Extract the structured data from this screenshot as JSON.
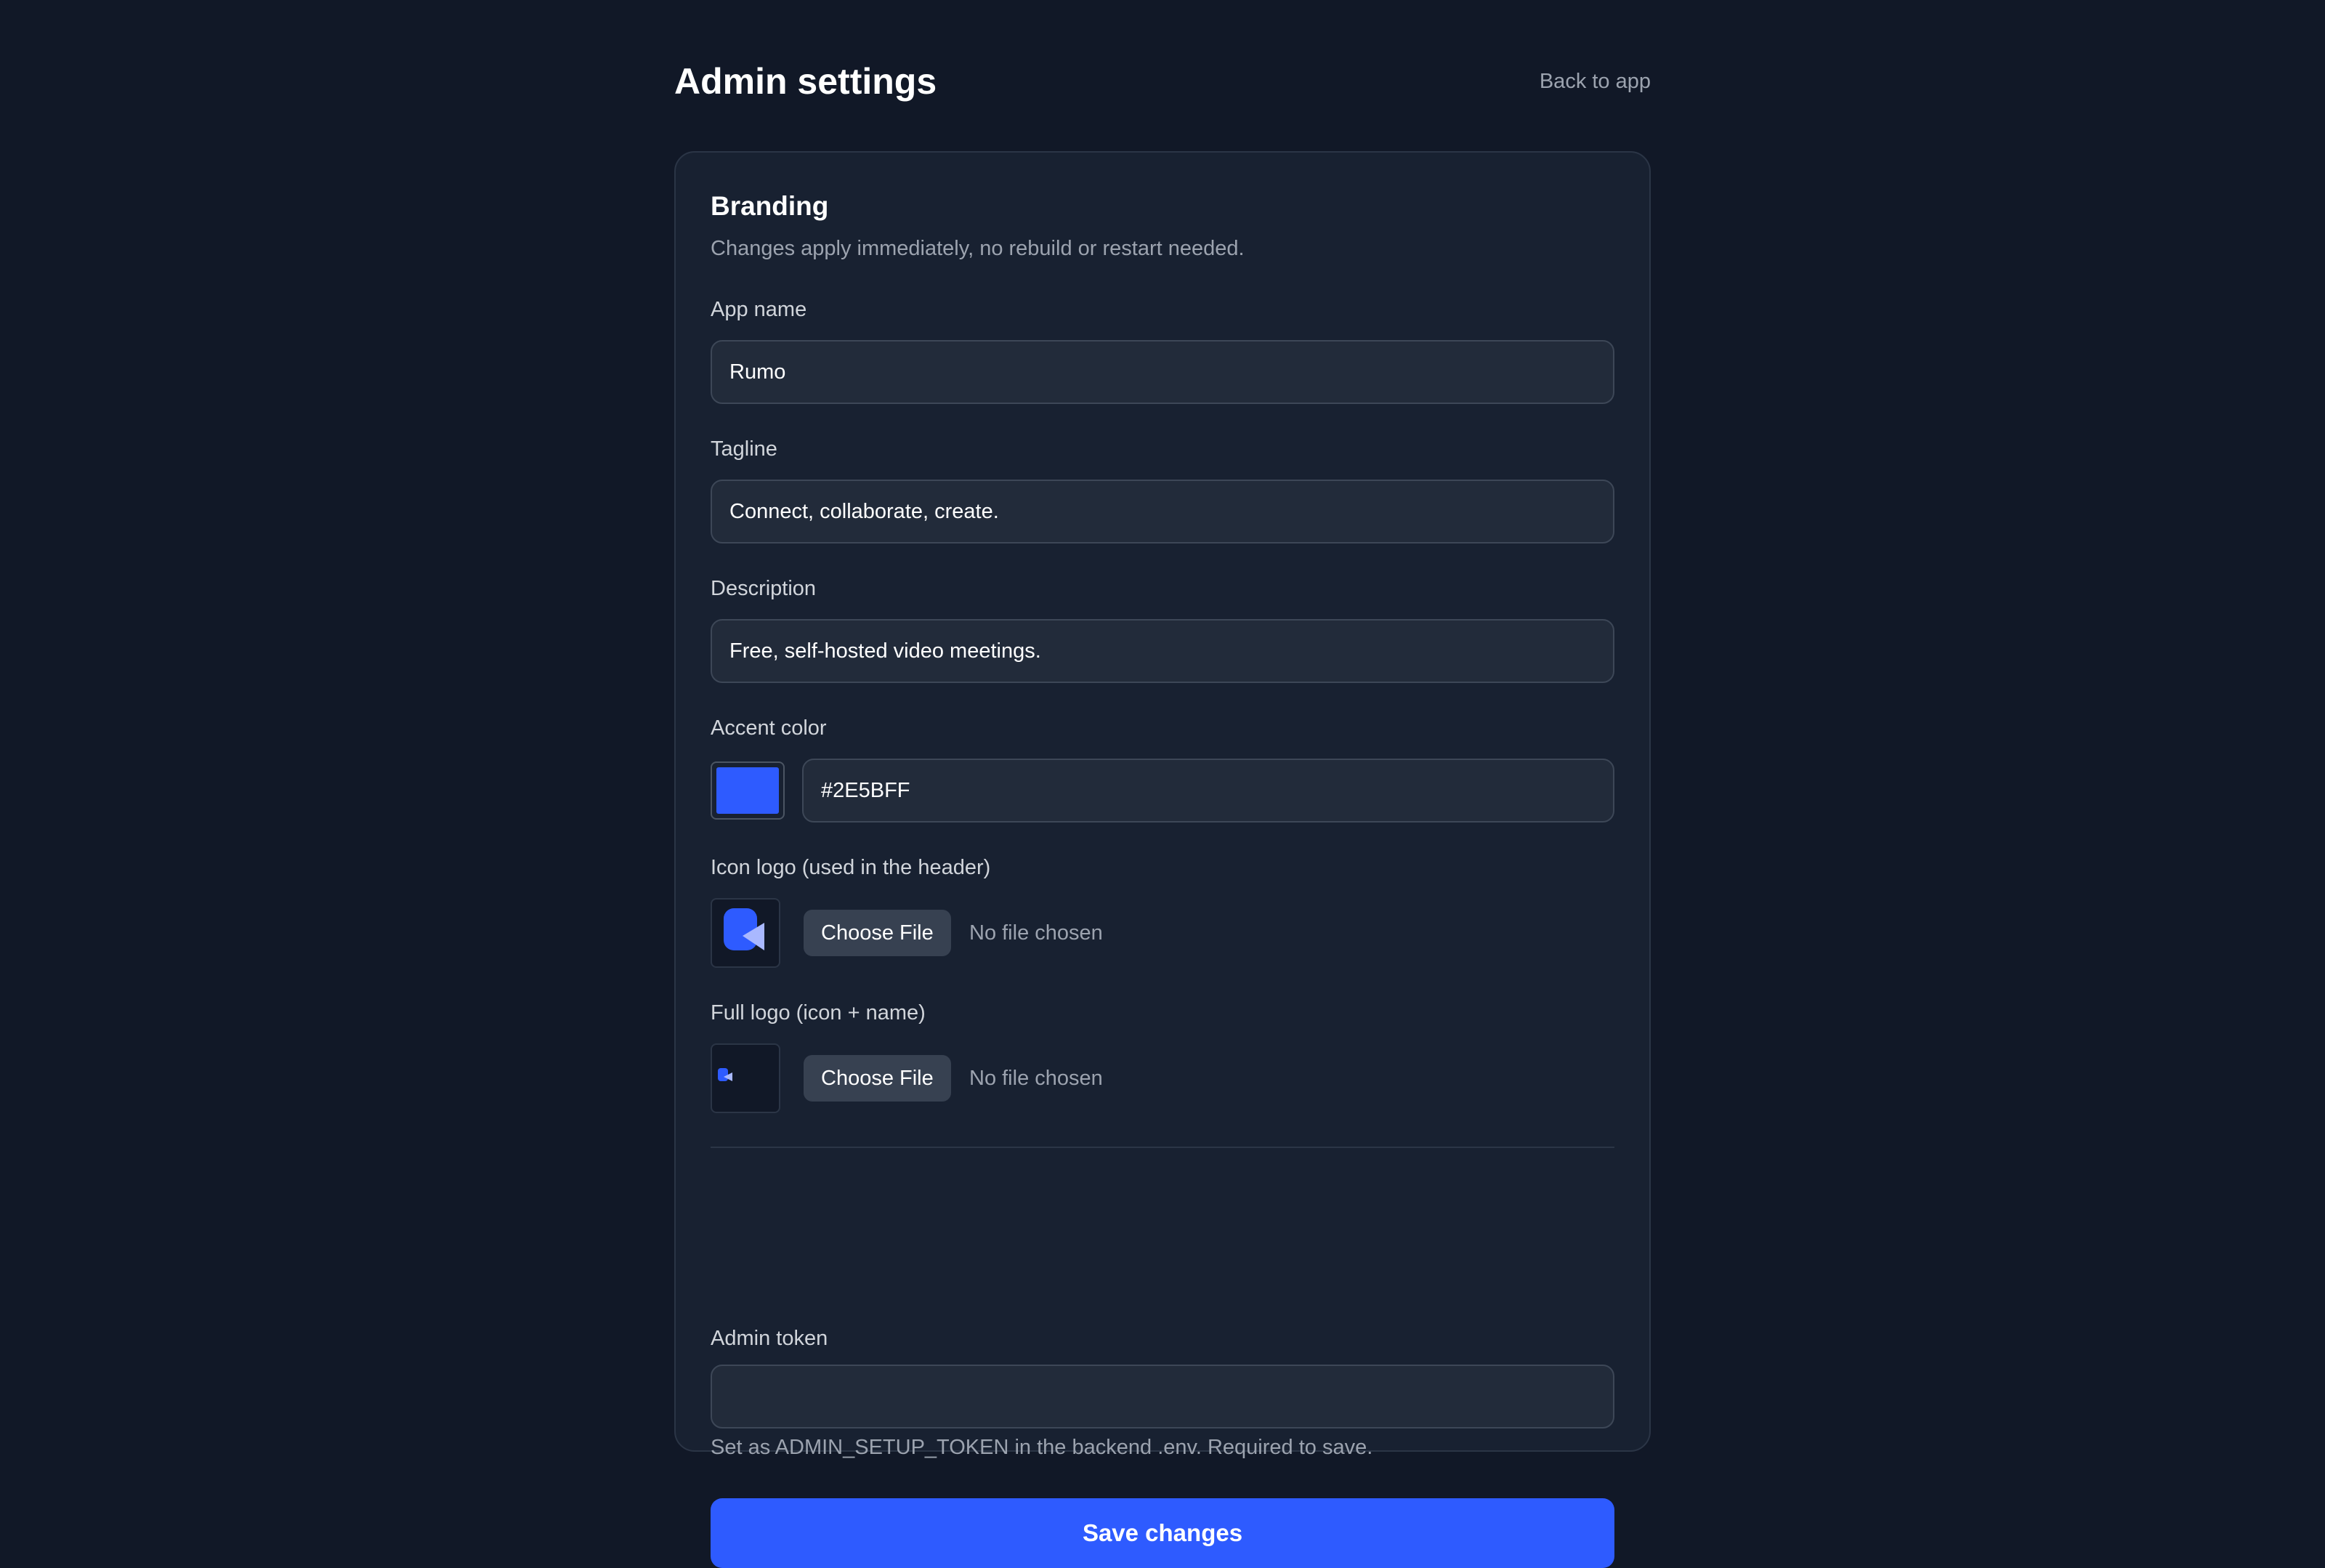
{
  "header": {
    "title": "Admin settings",
    "back_link": "Back to app"
  },
  "branding": {
    "title": "Branding",
    "subtitle": "Changes apply immediately, no rebuild or restart needed.",
    "app_name": {
      "label": "App name",
      "value": "Rumo"
    },
    "tagline": {
      "label": "Tagline",
      "value": "Connect, collaborate, create."
    },
    "description": {
      "label": "Description",
      "value": "Free, self-hosted video meetings."
    },
    "accent_color": {
      "label": "Accent color",
      "value": "#2E5BFF"
    },
    "icon_logo": {
      "label": "Icon logo (used in the header)",
      "button": "Choose File",
      "status": "No file chosen"
    },
    "full_logo": {
      "label": "Full logo (icon + name)",
      "button": "Choose File",
      "status": "No file chosen"
    },
    "admin_token": {
      "label": "Admin token",
      "value": "",
      "help": "Set as ADMIN_SETUP_TOKEN in the backend .env. Required to save."
    },
    "save_button": "Save changes"
  },
  "colors": {
    "background": "#111827",
    "card": "#182131",
    "accent": "#2E5BFF",
    "logo_light": "#a9b8ff"
  },
  "icons": {
    "icon_logo": "rumo-logo-icon",
    "full_logo": "rumo-full-logo-icon"
  }
}
